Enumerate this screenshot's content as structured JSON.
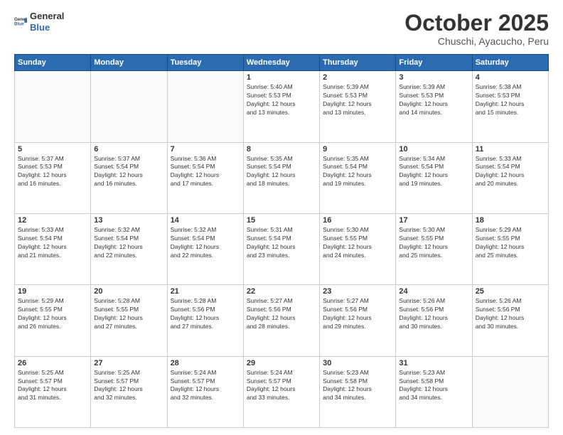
{
  "logo": {
    "line1": "General",
    "line2": "Blue"
  },
  "title": "October 2025",
  "subtitle": "Chuschi, Ayacucho, Peru",
  "weekdays": [
    "Sunday",
    "Monday",
    "Tuesday",
    "Wednesday",
    "Thursday",
    "Friday",
    "Saturday"
  ],
  "weeks": [
    [
      {
        "day": "",
        "info": ""
      },
      {
        "day": "",
        "info": ""
      },
      {
        "day": "",
        "info": ""
      },
      {
        "day": "1",
        "info": "Sunrise: 5:40 AM\nSunset: 5:53 PM\nDaylight: 12 hours\nand 13 minutes."
      },
      {
        "day": "2",
        "info": "Sunrise: 5:39 AM\nSunset: 5:53 PM\nDaylight: 12 hours\nand 13 minutes."
      },
      {
        "day": "3",
        "info": "Sunrise: 5:39 AM\nSunset: 5:53 PM\nDaylight: 12 hours\nand 14 minutes."
      },
      {
        "day": "4",
        "info": "Sunrise: 5:38 AM\nSunset: 5:53 PM\nDaylight: 12 hours\nand 15 minutes."
      }
    ],
    [
      {
        "day": "5",
        "info": "Sunrise: 5:37 AM\nSunset: 5:53 PM\nDaylight: 12 hours\nand 16 minutes."
      },
      {
        "day": "6",
        "info": "Sunrise: 5:37 AM\nSunset: 5:54 PM\nDaylight: 12 hours\nand 16 minutes."
      },
      {
        "day": "7",
        "info": "Sunrise: 5:36 AM\nSunset: 5:54 PM\nDaylight: 12 hours\nand 17 minutes."
      },
      {
        "day": "8",
        "info": "Sunrise: 5:35 AM\nSunset: 5:54 PM\nDaylight: 12 hours\nand 18 minutes."
      },
      {
        "day": "9",
        "info": "Sunrise: 5:35 AM\nSunset: 5:54 PM\nDaylight: 12 hours\nand 19 minutes."
      },
      {
        "day": "10",
        "info": "Sunrise: 5:34 AM\nSunset: 5:54 PM\nDaylight: 12 hours\nand 19 minutes."
      },
      {
        "day": "11",
        "info": "Sunrise: 5:33 AM\nSunset: 5:54 PM\nDaylight: 12 hours\nand 20 minutes."
      }
    ],
    [
      {
        "day": "12",
        "info": "Sunrise: 5:33 AM\nSunset: 5:54 PM\nDaylight: 12 hours\nand 21 minutes."
      },
      {
        "day": "13",
        "info": "Sunrise: 5:32 AM\nSunset: 5:54 PM\nDaylight: 12 hours\nand 22 minutes."
      },
      {
        "day": "14",
        "info": "Sunrise: 5:32 AM\nSunset: 5:54 PM\nDaylight: 12 hours\nand 22 minutes."
      },
      {
        "day": "15",
        "info": "Sunrise: 5:31 AM\nSunset: 5:54 PM\nDaylight: 12 hours\nand 23 minutes."
      },
      {
        "day": "16",
        "info": "Sunrise: 5:30 AM\nSunset: 5:55 PM\nDaylight: 12 hours\nand 24 minutes."
      },
      {
        "day": "17",
        "info": "Sunrise: 5:30 AM\nSunset: 5:55 PM\nDaylight: 12 hours\nand 25 minutes."
      },
      {
        "day": "18",
        "info": "Sunrise: 5:29 AM\nSunset: 5:55 PM\nDaylight: 12 hours\nand 25 minutes."
      }
    ],
    [
      {
        "day": "19",
        "info": "Sunrise: 5:29 AM\nSunset: 5:55 PM\nDaylight: 12 hours\nand 26 minutes."
      },
      {
        "day": "20",
        "info": "Sunrise: 5:28 AM\nSunset: 5:55 PM\nDaylight: 12 hours\nand 27 minutes."
      },
      {
        "day": "21",
        "info": "Sunrise: 5:28 AM\nSunset: 5:56 PM\nDaylight: 12 hours\nand 27 minutes."
      },
      {
        "day": "22",
        "info": "Sunrise: 5:27 AM\nSunset: 5:56 PM\nDaylight: 12 hours\nand 28 minutes."
      },
      {
        "day": "23",
        "info": "Sunrise: 5:27 AM\nSunset: 5:56 PM\nDaylight: 12 hours\nand 29 minutes."
      },
      {
        "day": "24",
        "info": "Sunrise: 5:26 AM\nSunset: 5:56 PM\nDaylight: 12 hours\nand 30 minutes."
      },
      {
        "day": "25",
        "info": "Sunrise: 5:26 AM\nSunset: 5:56 PM\nDaylight: 12 hours\nand 30 minutes."
      }
    ],
    [
      {
        "day": "26",
        "info": "Sunrise: 5:25 AM\nSunset: 5:57 PM\nDaylight: 12 hours\nand 31 minutes."
      },
      {
        "day": "27",
        "info": "Sunrise: 5:25 AM\nSunset: 5:57 PM\nDaylight: 12 hours\nand 32 minutes."
      },
      {
        "day": "28",
        "info": "Sunrise: 5:24 AM\nSunset: 5:57 PM\nDaylight: 12 hours\nand 32 minutes."
      },
      {
        "day": "29",
        "info": "Sunrise: 5:24 AM\nSunset: 5:57 PM\nDaylight: 12 hours\nand 33 minutes."
      },
      {
        "day": "30",
        "info": "Sunrise: 5:23 AM\nSunset: 5:58 PM\nDaylight: 12 hours\nand 34 minutes."
      },
      {
        "day": "31",
        "info": "Sunrise: 5:23 AM\nSunset: 5:58 PM\nDaylight: 12 hours\nand 34 minutes."
      },
      {
        "day": "",
        "info": ""
      }
    ]
  ]
}
